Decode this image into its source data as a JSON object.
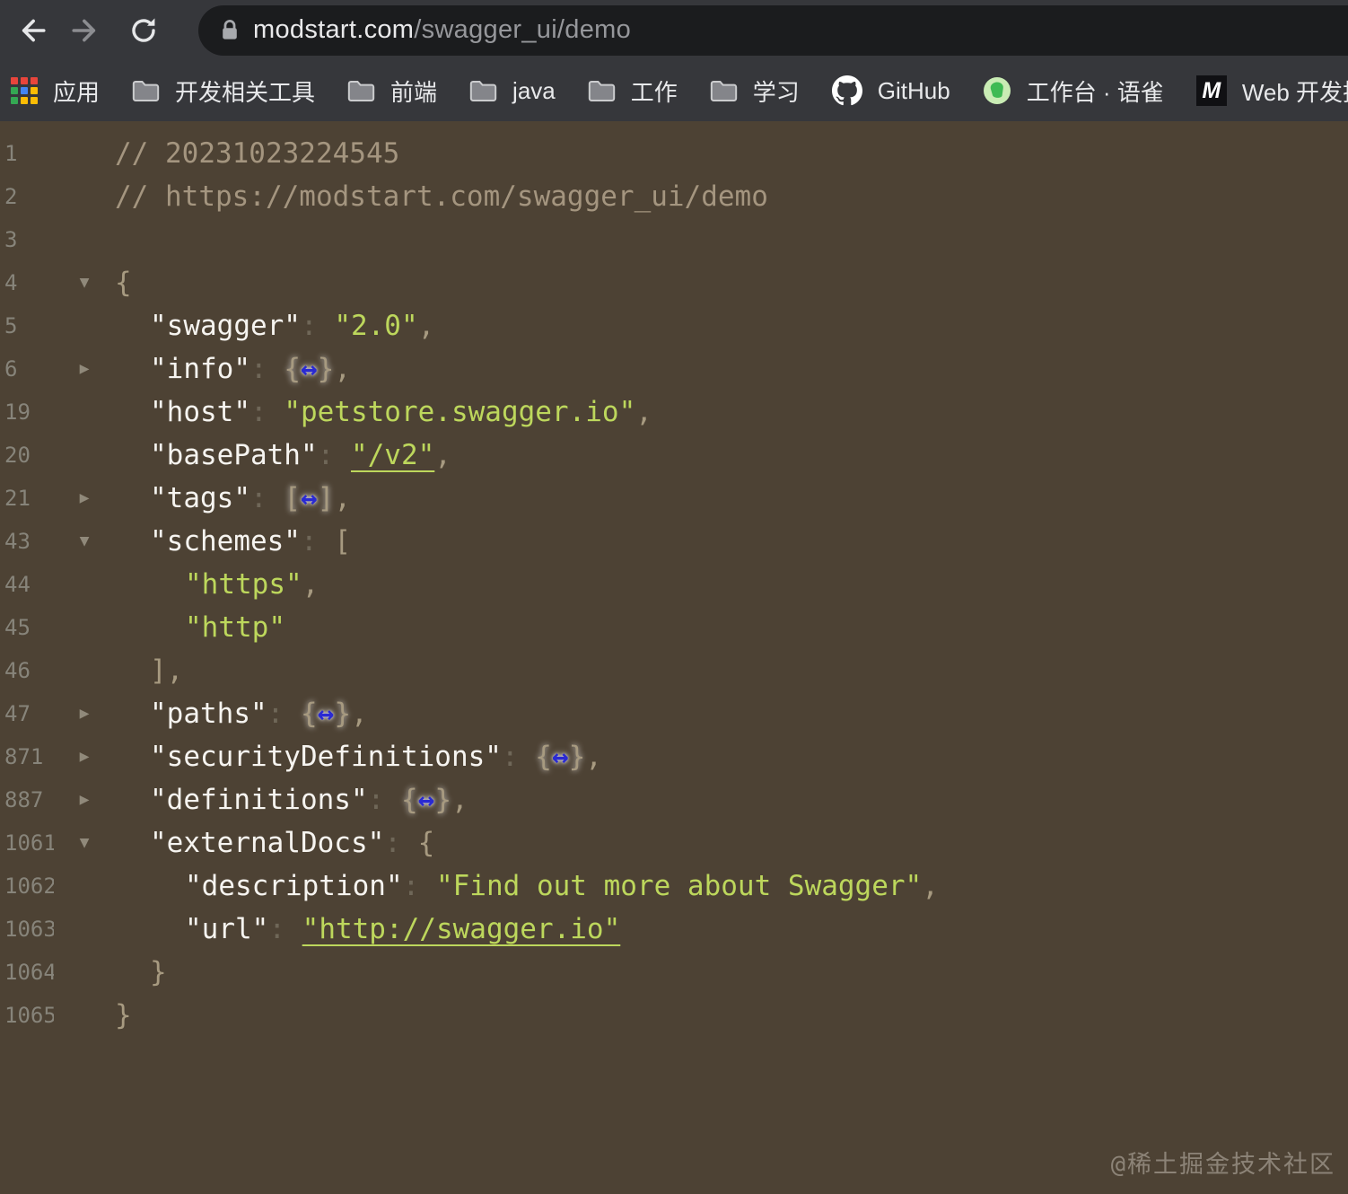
{
  "browser": {
    "url": {
      "host": "modstart.com",
      "path": "/swagger_ui/demo"
    }
  },
  "bookmarks_bar": {
    "apps_icon_colors": [
      "#e8453c",
      "#e8453c",
      "#e8453c",
      "#34a853",
      "#4285f4",
      "#fbbc05",
      "#34a853",
      "#fbbc05",
      "#fbbc05"
    ],
    "m_icon_text": "M",
    "items": [
      {
        "icon": "apps",
        "label": "应用"
      },
      {
        "icon": "folder",
        "label": "开发相关工具"
      },
      {
        "icon": "folder",
        "label": "前端"
      },
      {
        "icon": "folder",
        "label": "java"
      },
      {
        "icon": "folder",
        "label": "工作"
      },
      {
        "icon": "folder",
        "label": "学习"
      },
      {
        "icon": "github",
        "label": "GitHub"
      },
      {
        "icon": "yuque",
        "label": "工作台 · 语雀"
      },
      {
        "icon": "modstart",
        "label": "Web 开发技术 | M."
      }
    ]
  },
  "code": {
    "lines": [
      {
        "num": "1",
        "indent": 0,
        "fold": null,
        "tokens": [
          [
            "comment",
            "// 20231023224545"
          ]
        ]
      },
      {
        "num": "2",
        "indent": 0,
        "fold": null,
        "tokens": [
          [
            "comment",
            "// https://modstart.com/swagger_ui/demo"
          ]
        ]
      },
      {
        "num": "3",
        "indent": 0,
        "fold": null,
        "tokens": []
      },
      {
        "num": "4",
        "indent": 0,
        "fold": "v",
        "tokens": [
          [
            "punc",
            "{"
          ]
        ]
      },
      {
        "num": "5",
        "indent": 1,
        "fold": null,
        "tokens": [
          [
            "key",
            "\"swagger\""
          ],
          [
            "colon",
            ": "
          ],
          [
            "str",
            "\"2.0\""
          ],
          [
            "punc",
            ","
          ]
        ]
      },
      {
        "num": "6",
        "indent": 1,
        "fold": ">",
        "tokens": [
          [
            "key",
            "\"info\""
          ],
          [
            "colon",
            ": "
          ],
          [
            "expand",
            "{",
            "}"
          ],
          [
            "punc",
            ","
          ]
        ]
      },
      {
        "num": "19",
        "indent": 1,
        "fold": null,
        "tokens": [
          [
            "key",
            "\"host\""
          ],
          [
            "colon",
            ": "
          ],
          [
            "str",
            "\"petstore.swagger.io\""
          ],
          [
            "punc",
            ","
          ]
        ]
      },
      {
        "num": "20",
        "indent": 1,
        "fold": null,
        "tokens": [
          [
            "key",
            "\"basePath\""
          ],
          [
            "colon",
            ": "
          ],
          [
            "link",
            "\"/v2\""
          ],
          [
            "punc",
            ","
          ]
        ]
      },
      {
        "num": "21",
        "indent": 1,
        "fold": ">",
        "tokens": [
          [
            "key",
            "\"tags\""
          ],
          [
            "colon",
            ": "
          ],
          [
            "expand",
            "[",
            "]"
          ],
          [
            "punc",
            ","
          ]
        ]
      },
      {
        "num": "43",
        "indent": 1,
        "fold": "v",
        "tokens": [
          [
            "key",
            "\"schemes\""
          ],
          [
            "colon",
            ": "
          ],
          [
            "punc",
            "["
          ]
        ]
      },
      {
        "num": "44",
        "indent": 2,
        "fold": null,
        "tokens": [
          [
            "str",
            "\"https\""
          ],
          [
            "punc",
            ","
          ]
        ]
      },
      {
        "num": "45",
        "indent": 2,
        "fold": null,
        "tokens": [
          [
            "str",
            "\"http\""
          ]
        ]
      },
      {
        "num": "46",
        "indent": 1,
        "fold": null,
        "tokens": [
          [
            "punc",
            "],"
          ]
        ]
      },
      {
        "num": "47",
        "indent": 1,
        "fold": ">",
        "tokens": [
          [
            "key",
            "\"paths\""
          ],
          [
            "colon",
            ": "
          ],
          [
            "expand",
            "{",
            "}"
          ],
          [
            "punc",
            ","
          ]
        ]
      },
      {
        "num": "871",
        "indent": 1,
        "fold": ">",
        "tokens": [
          [
            "key",
            "\"securityDefinitions\""
          ],
          [
            "colon",
            ": "
          ],
          [
            "expand",
            "{",
            "}"
          ],
          [
            "punc",
            ","
          ]
        ]
      },
      {
        "num": "887",
        "indent": 1,
        "fold": ">",
        "tokens": [
          [
            "key",
            "\"definitions\""
          ],
          [
            "colon",
            ": "
          ],
          [
            "expand",
            "{",
            "}"
          ],
          [
            "punc",
            ","
          ]
        ]
      },
      {
        "num": "1061",
        "indent": 1,
        "fold": "v",
        "tokens": [
          [
            "key",
            "\"externalDocs\""
          ],
          [
            "colon",
            ": "
          ],
          [
            "punc",
            "{"
          ]
        ]
      },
      {
        "num": "1062",
        "indent": 2,
        "fold": null,
        "tokens": [
          [
            "key",
            "\"description\""
          ],
          [
            "colon",
            ": "
          ],
          [
            "str",
            "\"Find out more about Swagger\""
          ],
          [
            "punc",
            ","
          ]
        ]
      },
      {
        "num": "1063",
        "indent": 2,
        "fold": null,
        "tokens": [
          [
            "key",
            "\"url\""
          ],
          [
            "colon",
            ": "
          ],
          [
            "link",
            "\"http://swagger.io\""
          ]
        ]
      },
      {
        "num": "1064",
        "indent": 1,
        "fold": null,
        "tokens": [
          [
            "punc",
            "}"
          ]
        ]
      },
      {
        "num": "1065",
        "indent": 0,
        "fold": null,
        "tokens": [
          [
            "punc",
            "}"
          ]
        ]
      }
    ]
  },
  "watermark": "@稀土掘金技术社区",
  "colors": {
    "content_background": "#4d4234",
    "toolbar_gray": "#36373b",
    "address_pill_black": "#1b1c1e",
    "key_white": "#f6f4f0",
    "string_green": "#bdd75c",
    "punctuation_tan": "#a79a80",
    "comment_tan": "#a4957f",
    "line_number_gray": "#87847a",
    "expand_arrow_blue": "#2a2ad2"
  }
}
